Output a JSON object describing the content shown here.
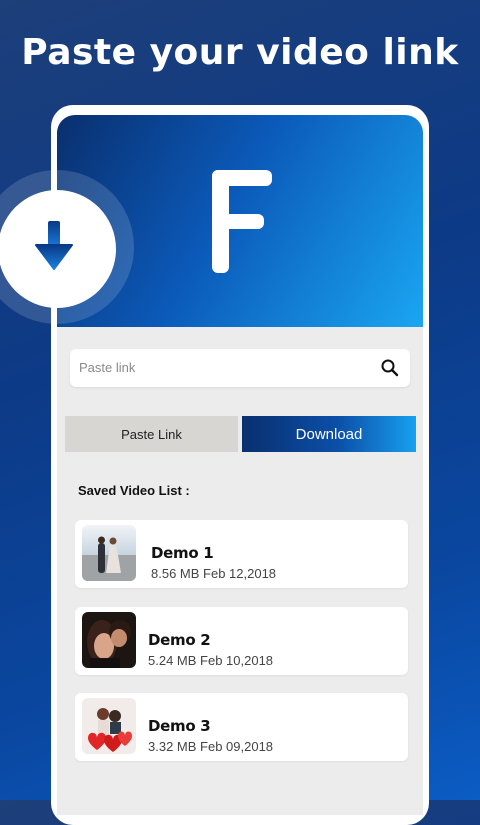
{
  "headline": "Paste your video link",
  "logo_letter": "F",
  "search": {
    "placeholder": "Paste link"
  },
  "buttons": {
    "paste_link": "Paste Link",
    "download": "Download"
  },
  "saved_list": {
    "title": "Saved Video List :",
    "items": [
      {
        "name": "Demo 1",
        "meta": "8.56 MB Feb 12,2018",
        "thumb": "couple-beach-thumbnail"
      },
      {
        "name": "Demo 2",
        "meta": "5.24 MB Feb 10,2018",
        "thumb": "couple-portrait-thumbnail"
      },
      {
        "name": "Demo 3",
        "meta": "3.32 MB Feb 09,2018",
        "thumb": "couple-balloons-thumbnail"
      }
    ]
  },
  "icons": {
    "search": "search-icon",
    "download": "download-arrow-icon"
  },
  "colors": {
    "background": "#0d3a86",
    "accent_dark": "#0a2f6e",
    "accent_light": "#1aa6f2",
    "panel": "#ececec"
  }
}
